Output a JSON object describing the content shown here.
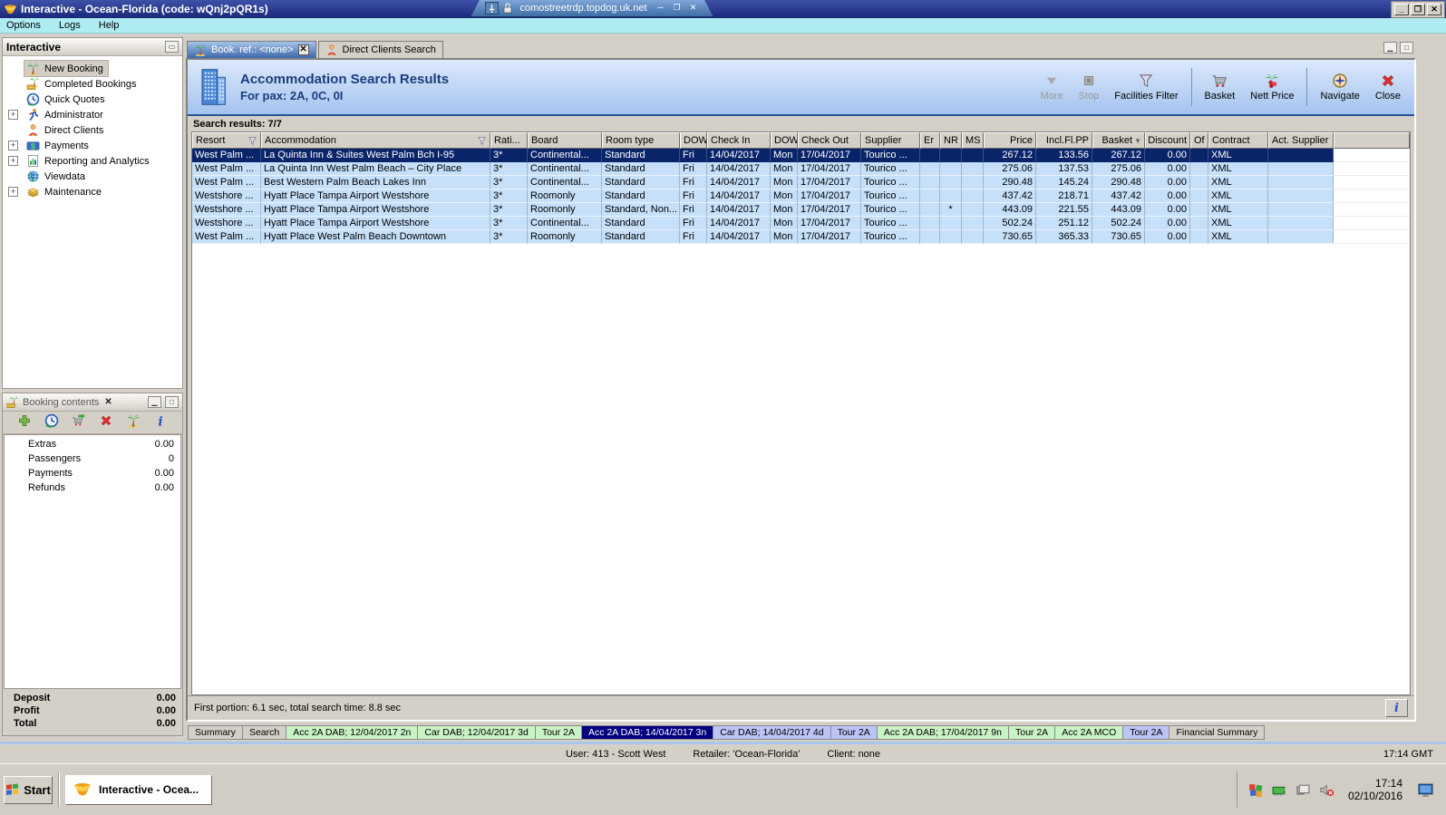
{
  "window": {
    "title": "Interactive - Ocean-Florida (code: wQnj2pQR1s)",
    "rdp_host": "comostreetrdp.topdog.uk.net",
    "menu": [
      "Options",
      "Logs",
      "Help"
    ]
  },
  "sidebar": {
    "title": "Interactive",
    "items": [
      {
        "label": "New Booking",
        "icon": "palm-tree-icon",
        "selected": true
      },
      {
        "label": "Completed Bookings",
        "icon": "completed-bookings-icon"
      },
      {
        "label": "Quick Quotes",
        "icon": "quick-quotes-icon"
      },
      {
        "label": "Administrator",
        "icon": "administrator-icon",
        "expandable": true
      },
      {
        "label": "Direct Clients",
        "icon": "direct-clients-icon"
      },
      {
        "label": "Payments",
        "icon": "payments-icon",
        "expandable": true
      },
      {
        "label": "Reporting and Analytics",
        "icon": "reporting-icon",
        "expandable": true
      },
      {
        "label": "Viewdata",
        "icon": "viewdata-icon"
      },
      {
        "label": "Maintenance",
        "icon": "maintenance-icon",
        "expandable": true
      }
    ]
  },
  "booking_contents": {
    "title": "Booking contents",
    "toolbar": [
      {
        "icon": "add-icon"
      },
      {
        "icon": "quick-quote-icon"
      },
      {
        "icon": "move-to-basket-icon"
      },
      {
        "icon": "delete-icon"
      },
      {
        "icon": "palm-tree-icon"
      },
      {
        "icon": "info-icon"
      }
    ],
    "rows": [
      {
        "label": "Extras",
        "value": "0.00"
      },
      {
        "label": "Passengers",
        "value": "0"
      },
      {
        "label": "Payments",
        "value": "0.00"
      },
      {
        "label": "Refunds",
        "value": "0.00"
      }
    ],
    "summary": [
      {
        "label": "Deposit",
        "value": "0.00"
      },
      {
        "label": "Profit",
        "value": "0.00"
      },
      {
        "label": "Total",
        "value": "0.00"
      }
    ]
  },
  "doc_tabs": [
    {
      "label": "Book. ref.: <none>",
      "icon": "palm-tree-icon",
      "active": true,
      "closable": true
    },
    {
      "label": "Direct Clients Search",
      "icon": "direct-clients-icon"
    }
  ],
  "results": {
    "title": "Accommodation Search Results",
    "subtitle": "For pax: 2A, 0C, 0I",
    "toolbar": [
      {
        "label": "More",
        "icon": "more-icon",
        "disabled": true
      },
      {
        "label": "Stop",
        "icon": "stop-icon",
        "disabled": true
      },
      {
        "label": "Facilities Filter",
        "icon": "facilities-filter-icon"
      },
      {
        "label": "Basket",
        "icon": "basket-icon",
        "separator_before": true
      },
      {
        "label": "Nett Price",
        "icon": "nett-price-icon"
      },
      {
        "label": "Navigate",
        "icon": "navigate-icon",
        "separator_before": true
      },
      {
        "label": "Close",
        "icon": "close-icon"
      }
    ],
    "count_label": "Search results: 7/7",
    "columns": [
      "Resort",
      "Accommodation",
      "Rati...",
      "Board",
      "Room type",
      "DOW",
      "Check In",
      "DOW",
      "Check Out",
      "Supplier",
      "Er",
      "NR",
      "MS",
      "Price",
      "Incl.Fl.PP",
      "Basket",
      "Discount",
      "Of",
      "Contract",
      "Act. Supplier"
    ],
    "rows": [
      [
        "West Palm ...",
        "La Quinta Inn & Suites West Palm Bch I-95",
        "3*",
        "Continental...",
        "Standard",
        "Fri",
        "14/04/2017",
        "Mon",
        "17/04/2017",
        "Tourico ...",
        "",
        "",
        "",
        "267.12",
        "133.56",
        "267.12",
        "0.00",
        "",
        "XML",
        ""
      ],
      [
        "West Palm ...",
        "La Quinta Inn West Palm Beach – City Place",
        "3*",
        "Continental...",
        "Standard",
        "Fri",
        "14/04/2017",
        "Mon",
        "17/04/2017",
        "Tourico ...",
        "",
        "",
        "",
        "275.06",
        "137.53",
        "275.06",
        "0.00",
        "",
        "XML",
        ""
      ],
      [
        "West Palm ...",
        "Best Western Palm Beach Lakes Inn",
        "3*",
        "Continental...",
        "Standard",
        "Fri",
        "14/04/2017",
        "Mon",
        "17/04/2017",
        "Tourico ...",
        "",
        "",
        "",
        "290.48",
        "145.24",
        "290.48",
        "0.00",
        "",
        "XML",
        ""
      ],
      [
        "Westshore ...",
        "Hyatt Place Tampa Airport Westshore",
        "3*",
        "Roomonly",
        "Standard",
        "Fri",
        "14/04/2017",
        "Mon",
        "17/04/2017",
        "Tourico ...",
        "",
        "",
        "",
        "437.42",
        "218.71",
        "437.42",
        "0.00",
        "",
        "XML",
        ""
      ],
      [
        "Westshore ...",
        "Hyatt Place Tampa Airport Westshore",
        "3*",
        "Roomonly",
        "Standard, Non...",
        "Fri",
        "14/04/2017",
        "Mon",
        "17/04/2017",
        "Tourico ...",
        "",
        "*",
        "",
        "443.09",
        "221.55",
        "443.09",
        "0.00",
        "",
        "XML",
        ""
      ],
      [
        "Westshore ...",
        "Hyatt Place Tampa Airport Westshore",
        "3*",
        "Continental...",
        "Standard",
        "Fri",
        "14/04/2017",
        "Mon",
        "17/04/2017",
        "Tourico ...",
        "",
        "",
        "",
        "502.24",
        "251.12",
        "502.24",
        "0.00",
        "",
        "XML",
        ""
      ],
      [
        "West Palm ...",
        "Hyatt Place West Palm Beach Downtown",
        "3*",
        "Roomonly",
        "Standard",
        "Fri",
        "14/04/2017",
        "Mon",
        "17/04/2017",
        "Tourico ...",
        "",
        "",
        "",
        "730.65",
        "365.33",
        "730.65",
        "0.00",
        "",
        "XML",
        ""
      ]
    ],
    "timing": "First portion: 6.1 sec, total search time: 8.8 sec"
  },
  "bottom_tabs": [
    {
      "label": "Summary",
      "color": "grey"
    },
    {
      "label": "Search",
      "color": "grey"
    },
    {
      "label": "Acc 2A DAB; 12/04/2017 2n",
      "color": "green"
    },
    {
      "label": "Car DAB; 12/04/2017 3d",
      "color": "green"
    },
    {
      "label": "Tour 2A",
      "color": "green"
    },
    {
      "label": "Acc 2A DAB; 14/04/2017 3n",
      "color": "selected"
    },
    {
      "label": "Car DAB; 14/04/2017 4d",
      "color": "lavender"
    },
    {
      "label": "Tour 2A",
      "color": "lavender"
    },
    {
      "label": "Acc 2A DAB; 17/04/2017 9n",
      "color": "green"
    },
    {
      "label": "Tour 2A",
      "color": "green"
    },
    {
      "label": "Acc 2A MCO",
      "color": "green"
    },
    {
      "label": "Tour 2A",
      "color": "lavender"
    },
    {
      "label": "Financial Summary",
      "color": "grey"
    }
  ],
  "status_bar": {
    "user": "User: 413 - Scott West",
    "retailer": "Retailer: 'Ocean-Florida'",
    "client": "Client: none",
    "time": "17:14 GMT"
  },
  "taskbar": {
    "start_label": "Start",
    "task_label": "Interactive - Ocea...",
    "tray_time": "17:14",
    "tray_date": "02/10/2016"
  }
}
